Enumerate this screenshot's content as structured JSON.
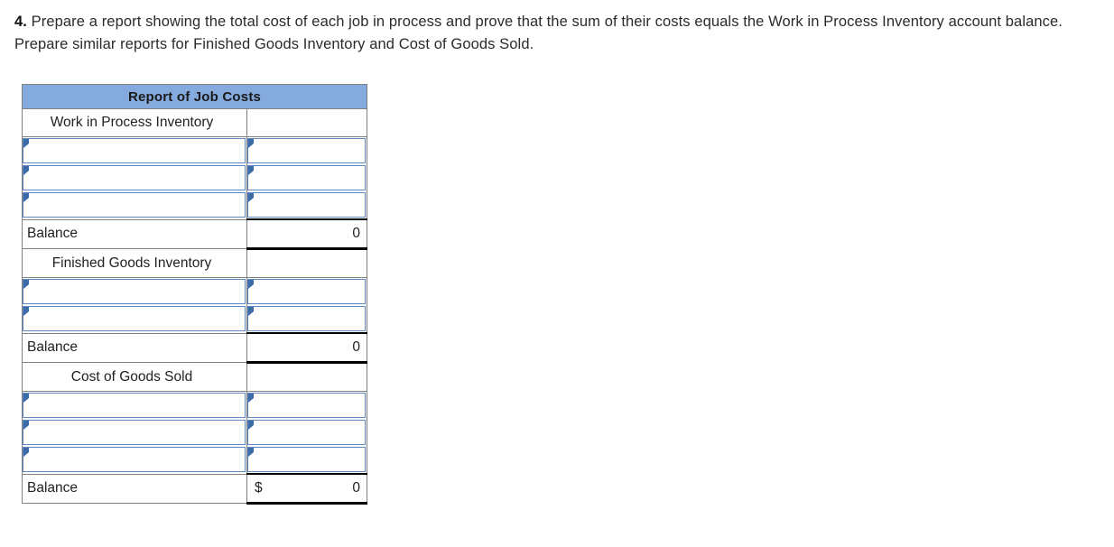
{
  "prompt": {
    "number": "4.",
    "text": " Prepare a report showing the total cost of each job in process and prove that the sum of their costs equals the Work in Process Inventory account balance. Prepare similar reports for Finished Goods Inventory and Cost of Goods Sold."
  },
  "worksheet": {
    "title": "Report of Job Costs",
    "colors": {
      "banner_background": "#85AADE",
      "grid_border": "#808080",
      "input_border": "#6089C4",
      "marker": "#3C6CA8",
      "rule": "#000000"
    },
    "sections": [
      {
        "heading": "Work in Process Inventory",
        "heading_value": "",
        "rows": [
          {
            "label": "",
            "value": ""
          },
          {
            "label": "",
            "value": ""
          },
          {
            "label": "",
            "value": ""
          }
        ],
        "balance": {
          "label": "Balance",
          "currency": "",
          "amount": "0"
        }
      },
      {
        "heading": "Finished Goods Inventory",
        "heading_value": "",
        "rows": [
          {
            "label": "",
            "value": ""
          },
          {
            "label": "",
            "value": ""
          }
        ],
        "balance": {
          "label": "Balance",
          "currency": "",
          "amount": "0"
        }
      },
      {
        "heading": "Cost of Goods Sold",
        "heading_value": "",
        "rows": [
          {
            "label": "",
            "value": ""
          },
          {
            "label": "",
            "value": ""
          },
          {
            "label": "",
            "value": ""
          }
        ],
        "balance": {
          "label": "Balance",
          "currency": "$",
          "amount": "0"
        }
      }
    ]
  }
}
